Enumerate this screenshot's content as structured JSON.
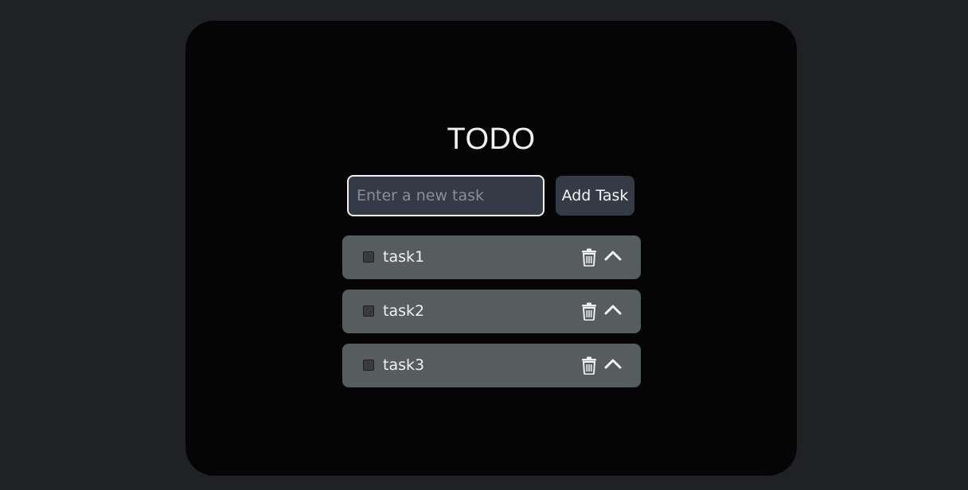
{
  "app": {
    "title": "TODO"
  },
  "input": {
    "value": "",
    "placeholder": "Enter a new task"
  },
  "add_button": {
    "label": "Add Task"
  },
  "tasks": [
    {
      "label": "task1",
      "checked": false,
      "delete_icon": "trash-icon",
      "move_icon": "chevron-up-icon"
    },
    {
      "label": "task2",
      "checked": false,
      "delete_icon": "trash-icon",
      "move_icon": "chevron-up-icon"
    },
    {
      "label": "task3",
      "checked": false,
      "delete_icon": "trash-icon",
      "move_icon": "chevron-up-icon"
    }
  ],
  "colors": {
    "page_background": "#202124",
    "card_background": "#050505",
    "input_background": "#343a46",
    "task_background": "#575c5f",
    "text": "#f2f2f2"
  }
}
